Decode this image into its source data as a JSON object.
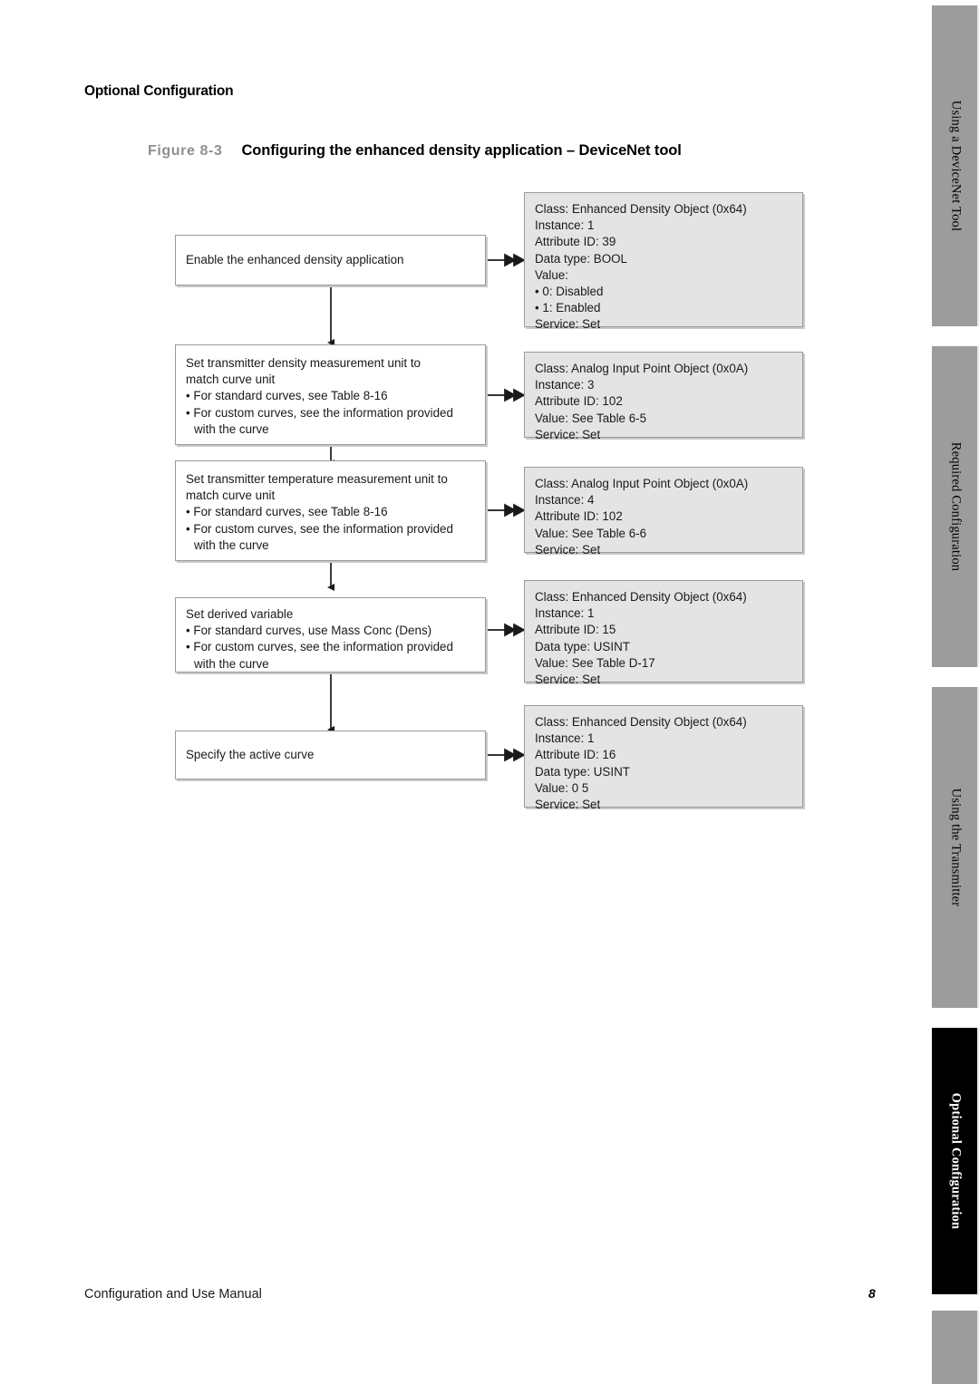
{
  "page": {
    "running_head": "Optional Configuration",
    "footer_left": "Configuration and Use Manual",
    "footer_page": "8"
  },
  "figure": {
    "number": "Figure 8-3",
    "title": "Configuring the enhanced density application – DeviceNet tool"
  },
  "flowchart": {
    "steps": [
      {
        "id": "enable-enhanced-density",
        "lines": [
          "Enable the enhanced density application"
        ],
        "bullets": [],
        "detail": {
          "lines": [
            "Class: Enhanced Density Object (0x64)",
            "Instance: 1",
            "Attribute ID: 39",
            "Data type: BOOL",
            "Value:",
            "• 0: Disabled",
            "• 1: Enabled",
            "Service: Set"
          ]
        }
      },
      {
        "id": "set-density-unit",
        "lines": [
          "Set transmitter density measurement unit to",
          "match curve unit"
        ],
        "bullets": [
          [
            "• For standard curves, see Table 8-16"
          ],
          [
            "• For custom curves, see the information provided",
            "with the curve"
          ]
        ],
        "detail": {
          "lines": [
            "Class: Analog Input Point Object (0x0A)",
            "Instance: 3",
            "Attribute ID: 102",
            "Value: See Table 6-5",
            "Service: Set"
          ]
        }
      },
      {
        "id": "set-temperature-unit",
        "lines": [
          "Set transmitter temperature measurement unit to",
          "match curve unit"
        ],
        "bullets": [
          [
            "• For standard curves, see Table 8-16"
          ],
          [
            "• For custom curves, see the information provided",
            "with the curve"
          ]
        ],
        "detail": {
          "lines": [
            "Class: Analog Input Point Object (0x0A)",
            "Instance: 4",
            "Attribute ID: 102",
            "Value: See Table 6-6",
            "Service: Set"
          ]
        }
      },
      {
        "id": "set-derived-variable",
        "lines": [
          "Set derived variable"
        ],
        "bullets": [
          [
            "• For standard curves, use Mass Conc (Dens)"
          ],
          [
            "• For custom curves, see the information provided",
            "with the curve"
          ]
        ],
        "detail": {
          "lines": [
            "Class: Enhanced Density Object (0x64)",
            "Instance: 1",
            "Attribute ID: 15",
            "Data type: USINT",
            "Value: See Table D-17",
            "Service: Set"
          ]
        }
      },
      {
        "id": "specify-active-curve",
        "lines": [
          "Specify the active curve"
        ],
        "bullets": [],
        "detail": {
          "lines": [
            "Class: Enhanced Density Object (0x64)",
            "Instance: 1",
            "Attribute ID: 16",
            "Data type: USINT",
            "Value: 0   5",
            "Service: Set"
          ]
        }
      }
    ]
  },
  "sidebar": {
    "tabs": [
      {
        "label": "Using a DeviceNet Tool",
        "active": false
      },
      {
        "label": "Required Configuration",
        "active": false
      },
      {
        "label": "Using the Transmitter",
        "active": false
      },
      {
        "label": "Optional Configuration",
        "active": true
      },
      {
        "label": "",
        "active": false
      }
    ]
  },
  "colors": {
    "tab_inactive": "#9c9c9c",
    "tab_active": "#000000",
    "detail_box_fill": "#e4e4e4",
    "box_border": "#9b9b9b",
    "figure_number": "#8f8f8f"
  }
}
